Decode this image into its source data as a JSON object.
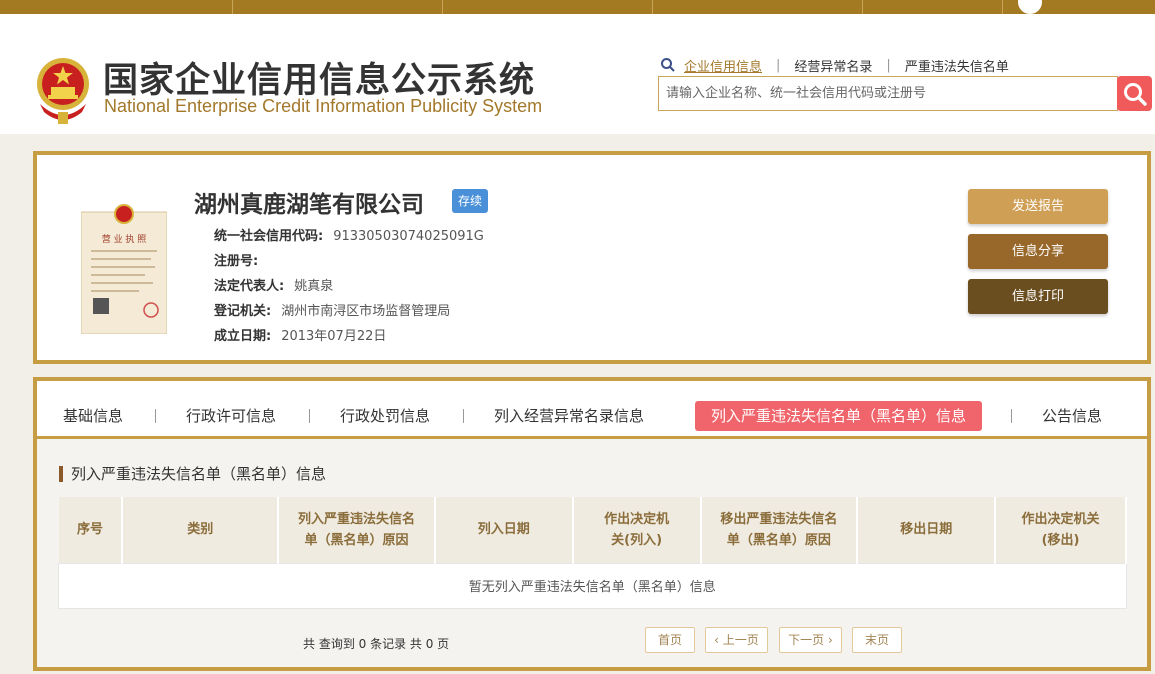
{
  "header": {
    "title": "国家企业信用信息公示系统",
    "subtitle": "National Enterprise Credit Information Publicity System"
  },
  "search": {
    "tabs": [
      "企业信用信息",
      "经营异常名录",
      "严重违法失信名单"
    ],
    "placeholder": "请输入企业名称、统一社会信用代码或注册号"
  },
  "company": {
    "name": "湖州真鹿湖笔有限公司",
    "status": "存续",
    "fields": [
      {
        "label": "统一社会信用代码:",
        "value": "91330503074025091G"
      },
      {
        "label": "注册号:",
        "value": ""
      },
      {
        "label": "法定代表人:",
        "value": "姚真泉"
      },
      {
        "label": "登记机关:",
        "value": "湖州市南浔区市场监督管理局"
      },
      {
        "label": "成立日期:",
        "value": "2013年07月22日"
      }
    ]
  },
  "actions": {
    "send": "发送报告",
    "share": "信息分享",
    "print": "信息打印"
  },
  "tabs": [
    "基础信息",
    "行政许可信息",
    "行政处罚信息",
    "列入经营异常名录信息",
    "列入严重违法失信名单（黑名单）信息",
    "公告信息"
  ],
  "section": {
    "title": "列入严重违法失信名单（黑名单）信息",
    "columns": [
      "序号",
      "类别",
      "列入严重违法失信名单（黑名单）原因",
      "列入日期",
      "作出决定机关(列入)",
      "移出严重违法失信名单（黑名单）原因",
      "移出日期",
      "作出决定机关(移出)"
    ],
    "empty": "暂无列入严重违法失信名单（黑名单）信息"
  },
  "pager": {
    "info": "共 查询到 0 条记录 共 0 页",
    "first": "首页",
    "prev": "上一页",
    "next": "下一页",
    "last": "末页"
  },
  "colors": {
    "gold": "#c79d43",
    "active_tab": "#f0646c",
    "badge": "#4a90d9"
  }
}
